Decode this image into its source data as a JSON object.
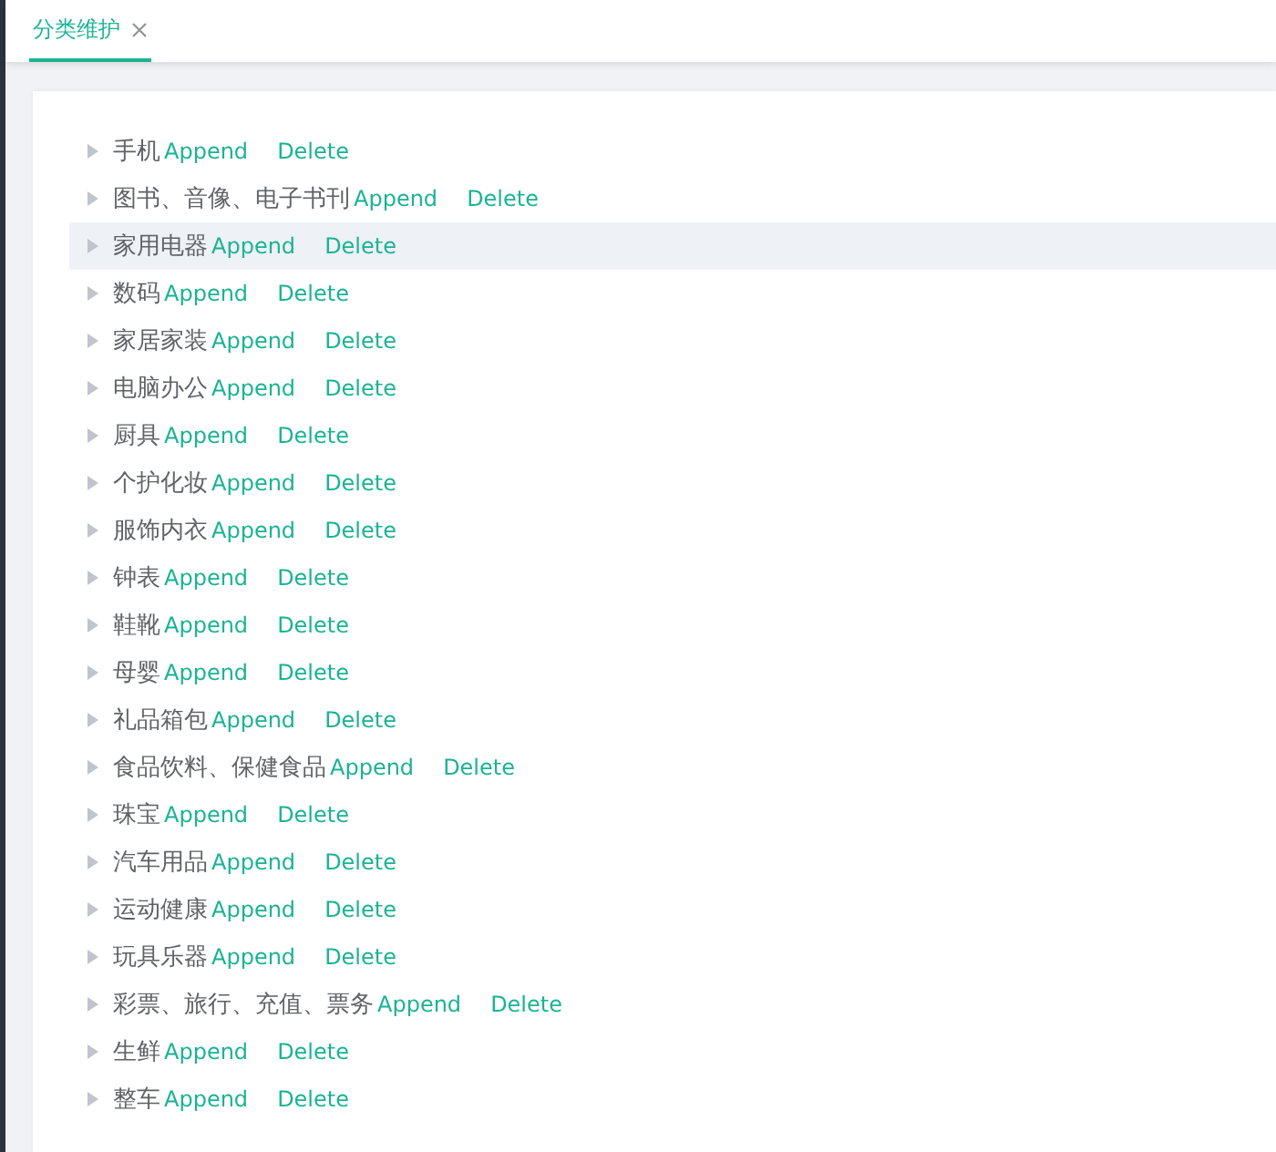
{
  "tabs": [
    {
      "label": "分类维护",
      "selected": true
    }
  ],
  "tree": {
    "nodes": [
      {
        "label": "手机",
        "expanded": false,
        "selected": false,
        "actions": [
          "Append",
          "Delete"
        ]
      },
      {
        "label": "图书、音像、电子书刊",
        "expanded": false,
        "selected": false,
        "actions": [
          "Append",
          "Delete"
        ]
      },
      {
        "label": "家用电器",
        "expanded": false,
        "selected": true,
        "actions": [
          "Append",
          "Delete"
        ]
      },
      {
        "label": "数码",
        "expanded": false,
        "selected": false,
        "actions": [
          "Append",
          "Delete"
        ]
      },
      {
        "label": "家居家装",
        "expanded": false,
        "selected": false,
        "actions": [
          "Append",
          "Delete"
        ]
      },
      {
        "label": "电脑办公",
        "expanded": false,
        "selected": false,
        "actions": [
          "Append",
          "Delete"
        ]
      },
      {
        "label": "厨具",
        "expanded": false,
        "selected": false,
        "actions": [
          "Append",
          "Delete"
        ]
      },
      {
        "label": "个护化妆",
        "expanded": false,
        "selected": false,
        "actions": [
          "Append",
          "Delete"
        ]
      },
      {
        "label": "服饰内衣",
        "expanded": false,
        "selected": false,
        "actions": [
          "Append",
          "Delete"
        ]
      },
      {
        "label": "钟表",
        "expanded": false,
        "selected": false,
        "actions": [
          "Append",
          "Delete"
        ]
      },
      {
        "label": "鞋靴",
        "expanded": false,
        "selected": false,
        "actions": [
          "Append",
          "Delete"
        ]
      },
      {
        "label": "母婴",
        "expanded": false,
        "selected": false,
        "actions": [
          "Append",
          "Delete"
        ]
      },
      {
        "label": "礼品箱包",
        "expanded": false,
        "selected": false,
        "actions": [
          "Append",
          "Delete"
        ]
      },
      {
        "label": "食品饮料、保健食品",
        "expanded": false,
        "selected": false,
        "actions": [
          "Append",
          "Delete"
        ]
      },
      {
        "label": "珠宝",
        "expanded": false,
        "selected": false,
        "actions": [
          "Append",
          "Delete"
        ]
      },
      {
        "label": "汽车用品",
        "expanded": false,
        "selected": false,
        "actions": [
          "Append",
          "Delete"
        ]
      },
      {
        "label": "运动健康",
        "expanded": false,
        "selected": false,
        "actions": [
          "Append",
          "Delete"
        ]
      },
      {
        "label": "玩具乐器",
        "expanded": false,
        "selected": false,
        "actions": [
          "Append",
          "Delete"
        ]
      },
      {
        "label": "彩票、旅行、充值、票务",
        "expanded": false,
        "selected": false,
        "actions": [
          "Append",
          "Delete"
        ]
      },
      {
        "label": "生鲜",
        "expanded": false,
        "selected": false,
        "actions": [
          "Append",
          "Delete"
        ]
      },
      {
        "label": "整车",
        "expanded": false,
        "selected": false,
        "actions": [
          "Append",
          "Delete"
        ]
      }
    ]
  }
}
